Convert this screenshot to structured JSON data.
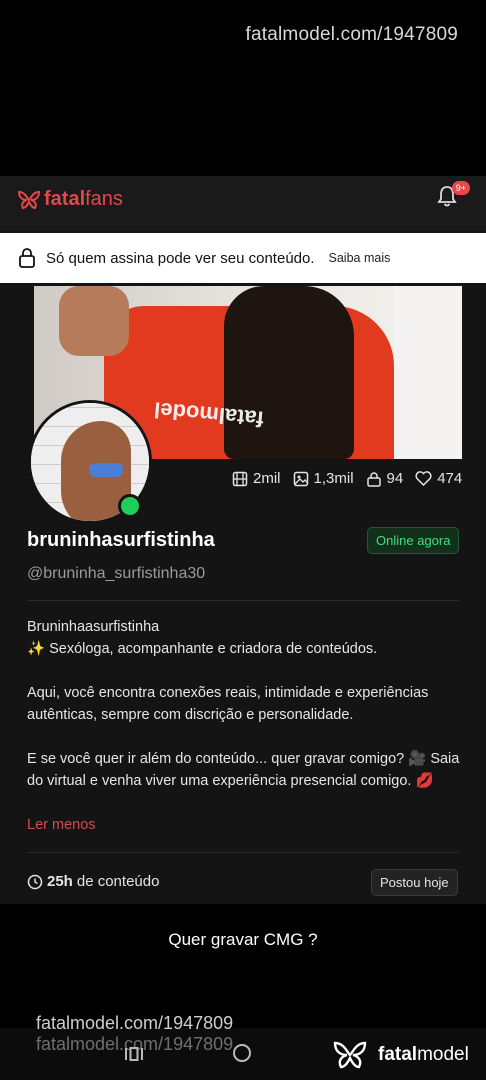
{
  "watermark": {
    "top": "fatalmodel.com/1947809",
    "bottom": "fatalmodel.com/1947809",
    "bottom_ghost": "fatalmodel.com/1947809"
  },
  "header": {
    "brand_bold": "fatal",
    "brand_light": "fans",
    "notifications_badge": "9+"
  },
  "lock_banner": {
    "message": "Só quem assina pode ver seu conteúdo.",
    "link": "Saiba mais"
  },
  "stats": {
    "videos": "2mil",
    "photos": "1,3mil",
    "locked": "94",
    "likes": "474"
  },
  "profile": {
    "username": "bruninhasurfistinha",
    "status": "Online agora",
    "handle": "@bruninha_surfistinha30"
  },
  "bio": {
    "line1": "Bruninhaasurfistinha",
    "line2": "✨ Sexóloga, acompanhante e criadora de conteúdos.",
    "para2": "Aqui, você encontra conexões reais, intimidade e experiências autênticas, sempre com discrição e personalidade.",
    "para3": "E se você quer ir além do conteúdo... quer gravar comigo? 🎥 Saia do virtual e venha viver uma experiência presencial comigo. 💋",
    "read_less": "Ler menos"
  },
  "content_info": {
    "hours": "25h",
    "hours_label": "de conteúdo",
    "posted": "Postou hoje"
  },
  "caption": "Quer gravar CMG ?",
  "footer_brand": {
    "bold": "fatal",
    "light": "model"
  },
  "colors": {
    "brand": "#e8464a",
    "online": "#1fcf5a"
  }
}
